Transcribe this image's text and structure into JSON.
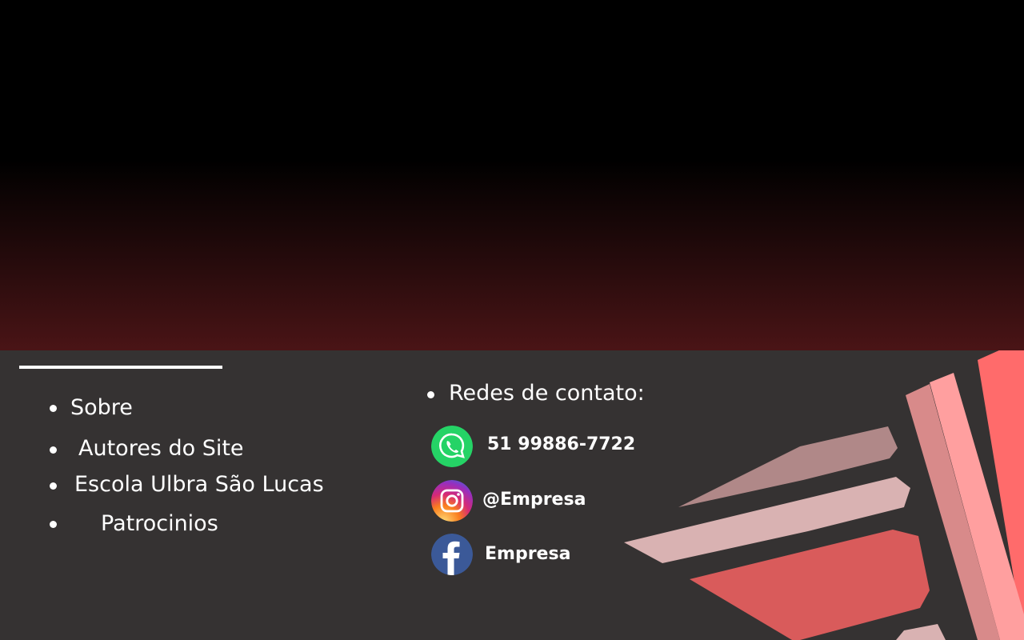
{
  "footer": {
    "links": [
      {
        "label": "Sobre"
      },
      {
        "label": "Autores do Site"
      },
      {
        "label": "Escola Ulbra São Lucas"
      },
      {
        "label": "Patrocinios"
      }
    ],
    "contacts": {
      "title": "Redes de contato:",
      "items": [
        {
          "icon": "whatsapp-icon",
          "text": "51 99886-7722",
          "color": "#25d366"
        },
        {
          "icon": "instagram-icon",
          "text": "@Empresa",
          "color": "#d62976"
        },
        {
          "icon": "facebook-icon",
          "text": "Empresa",
          "color": "#3b5998"
        }
      ]
    }
  },
  "colors": {
    "hero_top": "#000000",
    "hero_bottom": "#4a1416",
    "footer_bg": "#353232",
    "accent_red": "#ff6b6b",
    "accent_pink": "#d9b2b2"
  }
}
